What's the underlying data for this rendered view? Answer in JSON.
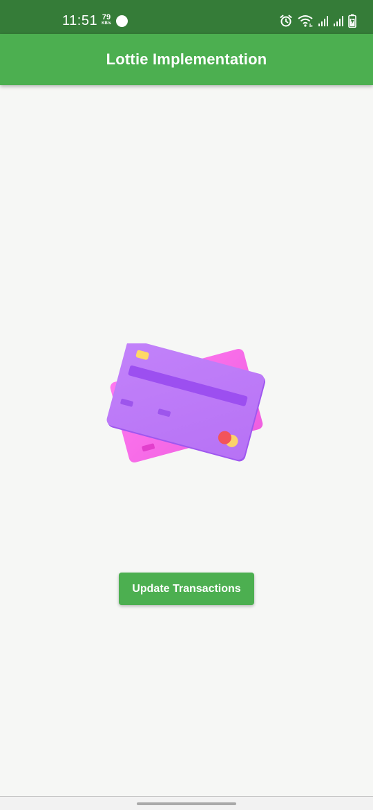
{
  "status_bar": {
    "time": "11:51",
    "net_speed_value": "79",
    "net_speed_unit": "KB/s",
    "icons": [
      "notification-dot-icon",
      "alarm-icon",
      "wifi-icon",
      "signal-icon",
      "signal-icon",
      "battery-charging-icon"
    ]
  },
  "app_bar": {
    "title": "Lottie Implementation",
    "color": "#4caf50"
  },
  "animation": {
    "name": "credit-cards-animation",
    "colors": {
      "back_card": "#f66ce9",
      "front_card": "#bb78f7",
      "chip": "#ffd966",
      "circle_red": "#f2545b",
      "circle_yellow": "#fcd26b"
    }
  },
  "actions": {
    "update_button_label": "Update Transactions"
  }
}
